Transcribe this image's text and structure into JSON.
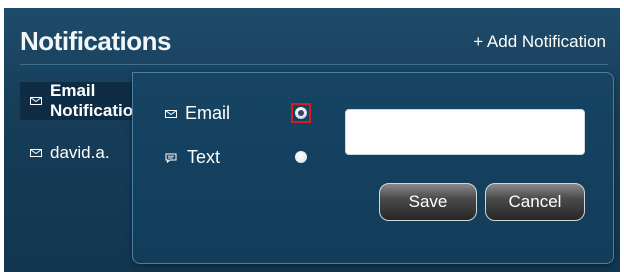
{
  "header": {
    "title": "Notifications",
    "add_label": "+ Add Notification"
  },
  "list": {
    "items": [
      {
        "label": "Email Notification",
        "icon": "envelope-icon",
        "active": true
      },
      {
        "label": "david.a.",
        "icon": "envelope-icon",
        "active": false
      }
    ]
  },
  "popup": {
    "options": [
      {
        "label": "Email",
        "icon": "envelope-icon",
        "selected": true
      },
      {
        "label": "Text",
        "icon": "speech-bubble-icon",
        "selected": false
      }
    ],
    "input": {
      "value": "",
      "placeholder": ""
    },
    "save_label": "Save",
    "cancel_label": "Cancel"
  },
  "colors": {
    "panel": "#163d58",
    "selected_row": "#0e2d45",
    "highlight_border": "#d11f1f"
  }
}
